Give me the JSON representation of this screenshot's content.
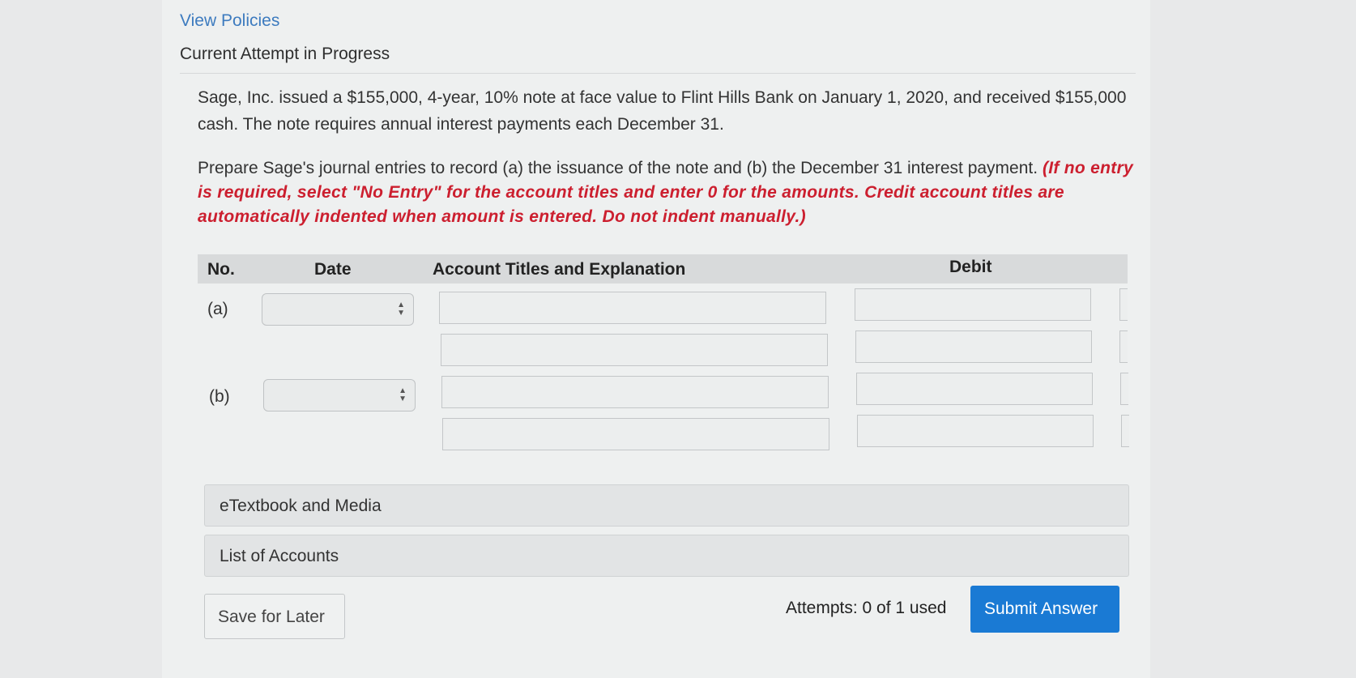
{
  "header": {
    "view_policies": "View Policies",
    "attempt_status": "Current Attempt in Progress"
  },
  "problem": {
    "text": "Sage, Inc. issued a $155,000, 4-year, 10% note at face value to Flint Hills Bank on January 1, 2020, and received $155,000 cash. The note requires annual interest payments each December 31.",
    "instruction": "Prepare Sage's journal entries to record (a) the issuance of the note and (b) the December 31 interest payment.",
    "instruction_note": "(If no entry is required, select \"No Entry\" for the account titles and enter 0 for the amounts. Credit account titles are automatically indented when amount is entered. Do not indent manually.)"
  },
  "table": {
    "columns": {
      "no": "No.",
      "date": "Date",
      "account": "Account Titles and Explanation",
      "debit": "Debit"
    },
    "entries": [
      {
        "label": "(a)",
        "date": "",
        "lines": [
          {
            "account": "",
            "debit": ""
          },
          {
            "account": "",
            "debit": ""
          }
        ]
      },
      {
        "label": "(b)",
        "date": "",
        "lines": [
          {
            "account": "",
            "debit": ""
          },
          {
            "account": "",
            "debit": ""
          }
        ]
      }
    ]
  },
  "panels": {
    "etextbook": "eTextbook and Media",
    "list_of_accounts": "List of Accounts"
  },
  "footer": {
    "save_label": "Save for Later",
    "attempts": "Attempts: 0 of 1 used",
    "submit_label": "Submit Answer"
  },
  "colors": {
    "link": "#3d7bbf",
    "instruction_red": "#cc1f2f",
    "submit_bg": "#1a7ad4"
  }
}
